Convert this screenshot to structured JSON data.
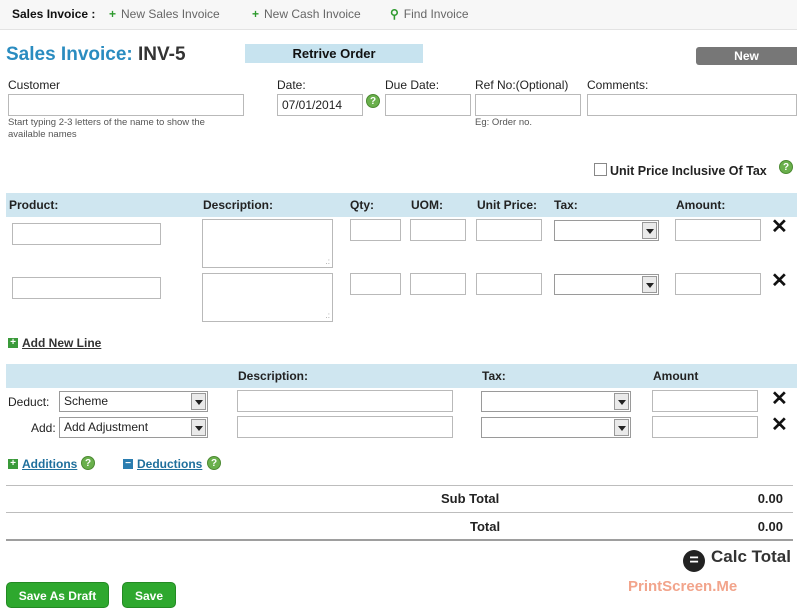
{
  "nav": {
    "label": "Sales Invoice :",
    "items": [
      {
        "icon": "plus-icon",
        "glyph": "+",
        "label": "New Sales Invoice"
      },
      {
        "icon": "plus-icon",
        "glyph": "+",
        "label": "New Cash Invoice"
      },
      {
        "icon": "search-icon",
        "glyph": "⚲",
        "label": "Find Invoice"
      }
    ]
  },
  "header": {
    "title_prefix": "Sales Invoice:",
    "invoice_number": "INV-5",
    "retrive_label": "Retrive Order",
    "new_label": "New"
  },
  "form": {
    "customer_label": "Customer",
    "customer_value": "",
    "customer_hint": "Start typing 2-3 letters of the name to show the available names",
    "date_label": "Date:",
    "date_value": "07/01/2014",
    "due_label": "Due Date:",
    "due_value": "",
    "ref_label": "Ref No:(Optional)",
    "ref_value": "",
    "ref_hint": "Eg: Order no.",
    "comments_label": "Comments:",
    "comments_value": "",
    "help_glyph": "?"
  },
  "unit_price": {
    "label": "Unit Price Inclusive Of Tax",
    "checked": false
  },
  "lines": {
    "columns": [
      "Product:",
      "Description:",
      "Qty:",
      "UOM:",
      "Unit Price:",
      "Tax:",
      "Amount:"
    ],
    "rows": [
      {
        "product": "",
        "description": "",
        "qty": "",
        "uom": "",
        "unit_price": "",
        "tax": "",
        "amount": ""
      },
      {
        "product": "",
        "description": "",
        "qty": "",
        "uom": "",
        "unit_price": "",
        "tax": "",
        "amount": ""
      }
    ],
    "delete_glyph": "✕",
    "add_line_label": "Add New Line",
    "plus_glyph": "+"
  },
  "adjustments": {
    "columns": [
      "Description:",
      "Tax:",
      "Amount"
    ],
    "rows": [
      {
        "label": "Deduct:",
        "type": "Scheme",
        "description": "",
        "tax": "",
        "amount": ""
      },
      {
        "label": "Add:",
        "type": "Add Adjustment",
        "description": "",
        "tax": "",
        "amount": ""
      }
    ],
    "additions_label": "Additions",
    "deductions_label": "Deductions",
    "minus_glyph": "−"
  },
  "totals": {
    "sub_total_label": "Sub Total",
    "sub_total_value": "0.00",
    "total_label": "Total",
    "total_value": "0.00"
  },
  "actions": {
    "calc_glyph": "=",
    "calc_label": "Calc Total",
    "save_draft_label": "Save As Draft",
    "save_label": "Save"
  },
  "watermark": "PrintScreen.Me",
  "colors": {
    "accent": "#2a8cc0",
    "band": "#cfe6f0",
    "green": "#2ea82e"
  }
}
